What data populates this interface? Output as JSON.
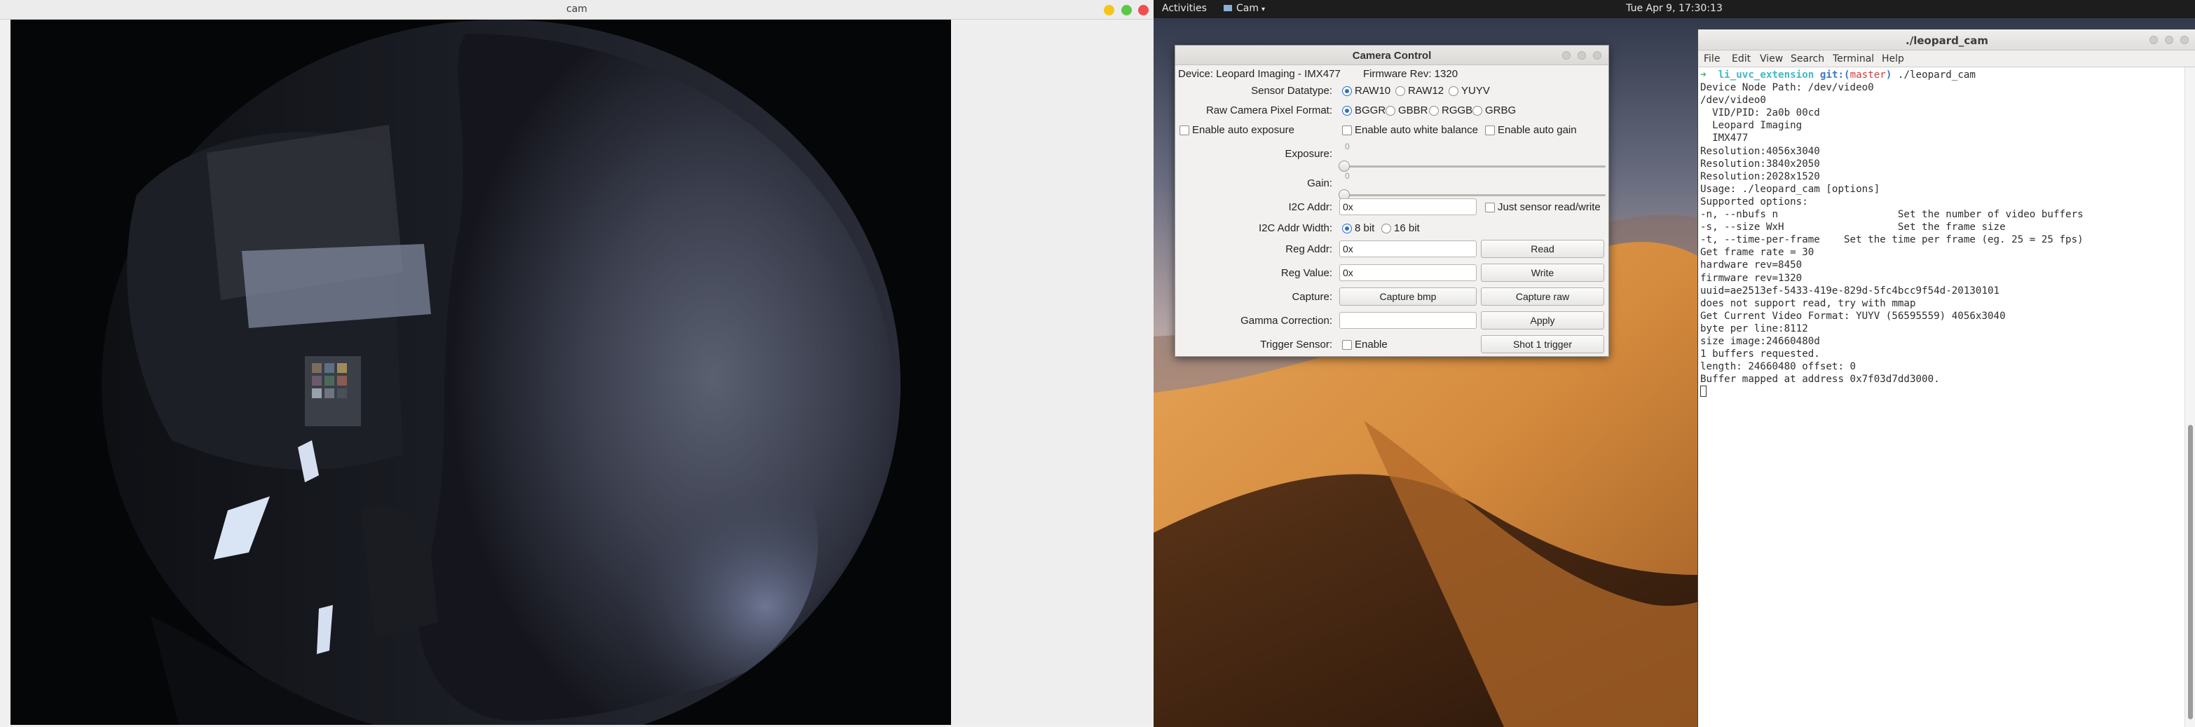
{
  "cam_window": {
    "title": "cam"
  },
  "topbar": {
    "activities": "Activities",
    "app_name": "Cam",
    "clock": "Tue Apr  9, 17:30:13"
  },
  "camera_control": {
    "title": "Camera Control",
    "device": "Device: Leopard Imaging - IMX477",
    "firmware": "Firmware Rev: 1320",
    "sensor_datatype_label": "Sensor Datatype:",
    "sensor_datatypes": [
      "RAW10",
      "RAW12",
      "YUYV"
    ],
    "sensor_datatype_selected": "RAW10",
    "pixel_format_label": "Raw Camera Pixel Format:",
    "pixel_formats": [
      "BGGR",
      "GBBR",
      "RGGB",
      "GRBG"
    ],
    "pixel_format_selected": "BGGR",
    "auto_exposure": "Enable auto exposure",
    "auto_white_balance": "Enable auto white balance",
    "auto_gain": "Enable auto gain",
    "exposure_label": "Exposure:",
    "exposure_value": "0",
    "gain_label": "Gain:",
    "gain_value": "0",
    "i2c_addr_label": "I2C Addr:",
    "i2c_addr_value": "0x",
    "just_sensor_rw": "Just sensor read/write",
    "i2c_width_label": "I2C Addr Width:",
    "i2c_widths": [
      "8 bit",
      "16 bit"
    ],
    "i2c_width_selected": "8 bit",
    "reg_addr_label": "Reg Addr:",
    "reg_addr_value": "0x",
    "read_button": "Read",
    "reg_value_label": "Reg Value:",
    "reg_value_value": "0x",
    "write_button": "Write",
    "capture_label": "Capture:",
    "capture_bmp_button": "Capture bmp",
    "capture_raw_button": "Capture raw",
    "gamma_label": "Gamma Correction:",
    "gamma_value": "",
    "apply_button": "Apply",
    "trigger_label": "Trigger Sensor:",
    "trigger_enable": "Enable",
    "shot_trigger_button": "Shot 1 trigger"
  },
  "terminal": {
    "title": "./leopard_cam",
    "menu": [
      "File",
      "Edit",
      "View",
      "Search",
      "Terminal",
      "Help"
    ],
    "prompt": {
      "arrow": "➜",
      "dir": "li_uvc_extension",
      "git": "git:(",
      "branch": "master",
      "git_close": ")",
      "command": "./leopard_cam"
    },
    "lines": [
      "Device Node Path: /dev/video0",
      "/dev/video0",
      "  VID/PID: 2a0b 00cd",
      "  Leopard Imaging",
      "  IMX477",
      "Resolution:4056x3040",
      "Resolution:3840x2050",
      "Resolution:2028x1520",
      "Usage: ./leopard_cam [options]",
      "Supported options:",
      "-n, --nbufs n                    Set the number of video buffers",
      "-s, --size WxH                   Set the frame size",
      "-t, --time-per-frame    Set the time per frame (eg. 25 = 25 fps)",
      "Get frame rate = 30",
      "hardware rev=8450",
      "firmware rev=1320",
      "uuid=ae2513ef-5433-419e-829d-5fc4bcc9f54d-20130101",
      "does not support read, try with mmap",
      "Get Current Video Format: YUYV (56595559) 4056x3040",
      "byte per line:8112",
      "size image:24660480d",
      "1 buffers requested.",
      "length: 24660480 offset: 0",
      "Buffer mapped at address 0x7f03d7dd3000."
    ]
  }
}
